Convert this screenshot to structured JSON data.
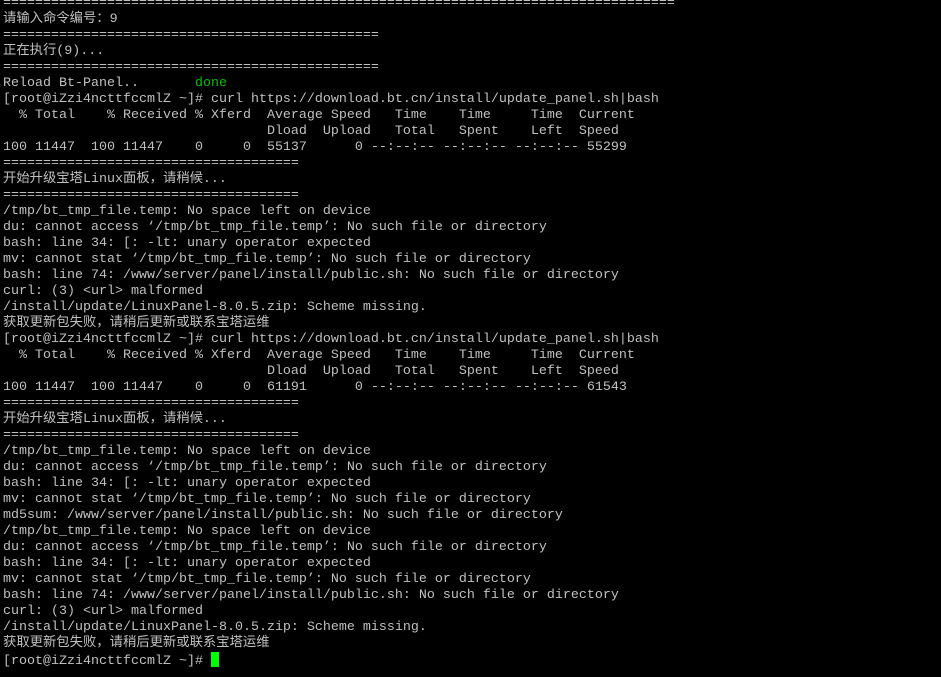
{
  "colors": {
    "background": "#000000",
    "text": "#c0c0c0",
    "success": "#00c000",
    "cursor": "#00ff00"
  },
  "terminal": {
    "lines": [
      [
        {
          "text": "===================================================================================="
        }
      ],
      [
        {
          "text": "请输入命令编号：9"
        }
      ],
      [
        {
          "text": "==============================================="
        }
      ],
      [
        {
          "text": "正在执行(9)..."
        }
      ],
      [
        {
          "text": "==============================================="
        }
      ],
      [
        {
          "text": "Reload Bt-Panel..       "
        },
        {
          "text": "done",
          "color": "success"
        }
      ],
      [
        {
          "text": "[root@iZzi4ncttfccmlZ ~]# curl https://download.bt.cn/install/update_panel.sh|bash"
        }
      ],
      [
        {
          "text": "  % Total    % Received % Xferd  Average Speed   Time    Time     Time  Current"
        }
      ],
      [
        {
          "text": "                                 Dload  Upload   Total   Spent    Left  Speed"
        }
      ],
      [
        {
          "text": "100 11447  100 11447    0     0  55137      0 --:--:-- --:--:-- --:--:-- 55299"
        }
      ],
      [
        {
          "text": "====================================="
        }
      ],
      [
        {
          "text": "开始升级宝塔Linux面板，请稍候..."
        }
      ],
      [
        {
          "text": "====================================="
        }
      ],
      [
        {
          "text": "/tmp/bt_tmp_file.temp: No space left on device"
        }
      ],
      [
        {
          "text": "du: cannot access ‘/tmp/bt_tmp_file.temp’: No such file or directory"
        }
      ],
      [
        {
          "text": "bash: line 34: [: -lt: unary operator expected"
        }
      ],
      [
        {
          "text": "mv: cannot stat ‘/tmp/bt_tmp_file.temp’: No such file or directory"
        }
      ],
      [
        {
          "text": "bash: line 74: /www/server/panel/install/public.sh: No such file or directory"
        }
      ],
      [
        {
          "text": "curl: (3) <url> malformed"
        }
      ],
      [
        {
          "text": "/install/update/LinuxPanel-8.0.5.zip: Scheme missing."
        }
      ],
      [
        {
          "text": "获取更新包失败，请稍后更新或联系宝塔运维"
        }
      ],
      [
        {
          "text": "[root@iZzi4ncttfccmlZ ~]# curl https://download.bt.cn/install/update_panel.sh|bash"
        }
      ],
      [
        {
          "text": "  % Total    % Received % Xferd  Average Speed   Time    Time     Time  Current"
        }
      ],
      [
        {
          "text": "                                 Dload  Upload   Total   Spent    Left  Speed"
        }
      ],
      [
        {
          "text": "100 11447  100 11447    0     0  61191      0 --:--:-- --:--:-- --:--:-- 61543"
        }
      ],
      [
        {
          "text": "====================================="
        }
      ],
      [
        {
          "text": "开始升级宝塔Linux面板，请稍候..."
        }
      ],
      [
        {
          "text": "====================================="
        }
      ],
      [
        {
          "text": "/tmp/bt_tmp_file.temp: No space left on device"
        }
      ],
      [
        {
          "text": "du: cannot access ‘/tmp/bt_tmp_file.temp’: No such file or directory"
        }
      ],
      [
        {
          "text": "bash: line 34: [: -lt: unary operator expected"
        }
      ],
      [
        {
          "text": "mv: cannot stat ‘/tmp/bt_tmp_file.temp’: No such file or directory"
        }
      ],
      [
        {
          "text": "md5sum: /www/server/panel/install/public.sh: No such file or directory"
        }
      ],
      [
        {
          "text": "/tmp/bt_tmp_file.temp: No space left on device"
        }
      ],
      [
        {
          "text": "du: cannot access ‘/tmp/bt_tmp_file.temp’: No such file or directory"
        }
      ],
      [
        {
          "text": "bash: line 34: [: -lt: unary operator expected"
        }
      ],
      [
        {
          "text": "mv: cannot stat ‘/tmp/bt_tmp_file.temp’: No such file or directory"
        }
      ],
      [
        {
          "text": "bash: line 74: /www/server/panel/install/public.sh: No such file or directory"
        }
      ],
      [
        {
          "text": "curl: (3) <url> malformed"
        }
      ],
      [
        {
          "text": "/install/update/LinuxPanel-8.0.5.zip: Scheme missing."
        }
      ],
      [
        {
          "text": "获取更新包失败，请稍后更新或联系宝塔运维"
        }
      ]
    ],
    "prompt": "[root@iZzi4ncttfccmlZ ~]# "
  }
}
